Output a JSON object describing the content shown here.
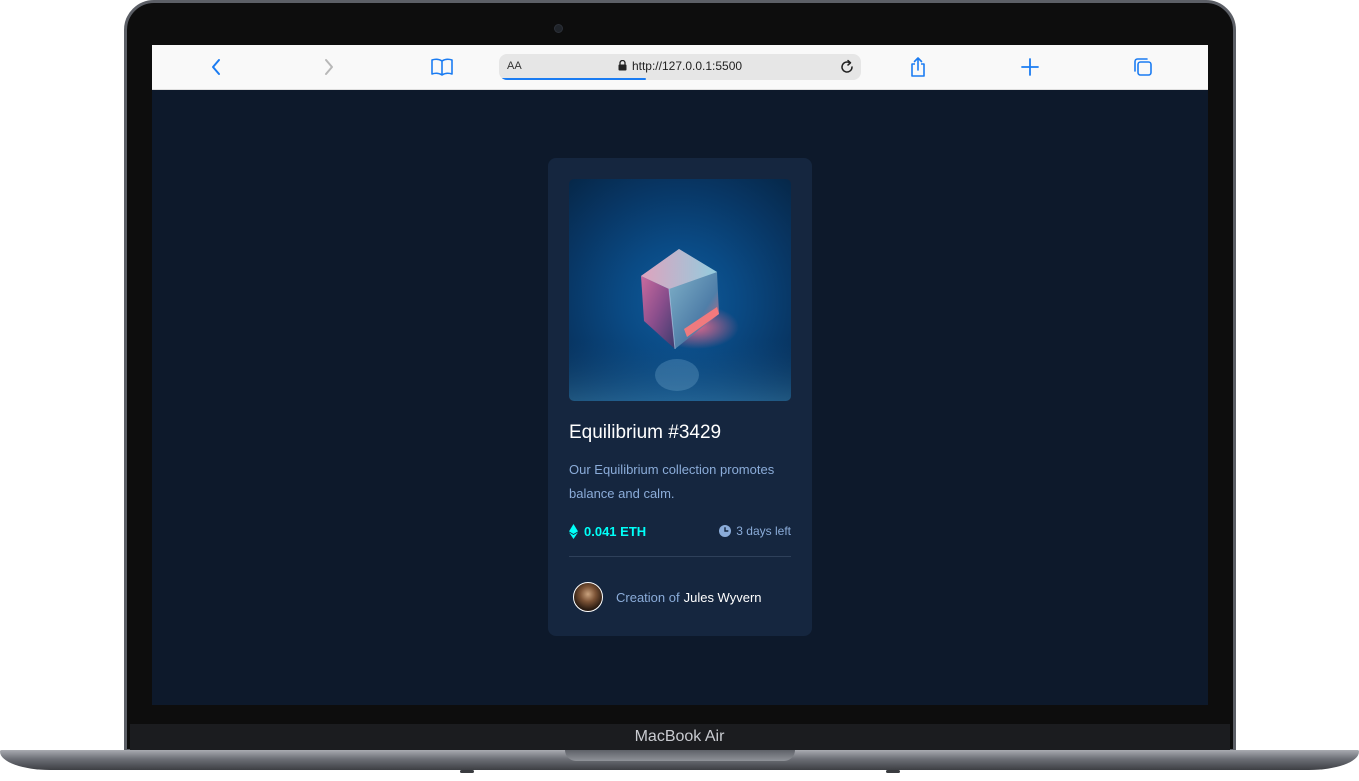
{
  "browser": {
    "text_size_label": "AA",
    "url": "http://127.0.0.1:5500",
    "load_progress": 0.4
  },
  "card": {
    "title": "Equilibrium #3429",
    "description": "Our Equilibrium collection promotes balance and calm.",
    "price": "0.041 ETH",
    "time_left": "3 days left",
    "creator_prefix": "Creation of",
    "creator_name": "Jules Wyvern"
  },
  "device": {
    "label": "MacBook Air"
  },
  "colors": {
    "page_background": "#0d192b",
    "card_background": "#15263f",
    "accent_cyan": "#00fff8",
    "soft_blue": "#8bacd9",
    "safari_blue": "#1b7cf2"
  },
  "icons": {
    "back": "chevron-left-icon",
    "forward": "chevron-right-icon",
    "bookmarks": "book-icon",
    "lock": "lock-icon",
    "reload": "reload-icon",
    "share": "share-icon",
    "new_tab": "plus-icon",
    "tabs": "tabs-icon",
    "ethereum": "ethereum-icon",
    "clock": "clock-icon"
  }
}
